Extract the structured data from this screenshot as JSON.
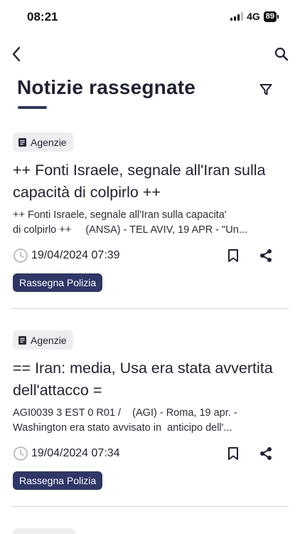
{
  "status": {
    "time": "08:21",
    "network": "4G",
    "battery": "89"
  },
  "header": {
    "title": "Notizie rassegnate"
  },
  "icons": {
    "back": "chevron-left-icon",
    "search": "search-icon",
    "filter": "filter-icon",
    "source": "document-icon",
    "clock": "clock-icon",
    "bookmark": "bookmark-icon",
    "share": "share-icon"
  },
  "colors": {
    "accent": "#2f3767",
    "badge_bg": "#eeeef0",
    "text": "#1f2233"
  },
  "articles": [
    {
      "source": "Agenzie",
      "title": "++ Fonti Israele, segnale all'Iran sulla capacità di colpirlo ++",
      "snippet_line1": "++ Fonti Israele, segnale all'Iran sulla capacita' ",
      "snippet_line2": "di colpirlo ++     (ANSA) - TEL AVIV, 19 APR - \"Un...",
      "datetime": "19/04/2024 07:39",
      "tag": "Rassegna Polizia"
    },
    {
      "source": "Agenzie",
      "title": "== Iran: media, Usa era stata avvertita dell'attacco =",
      "snippet_line1": "AGI0039 3 EST 0 R01 /    (AGI) - Roma, 19 apr. - ",
      "snippet_line2": "Washington era stato avvisato in  anticipo dell'...",
      "datetime": "19/04/2024 07:34",
      "tag": "Rassegna Polizia"
    }
  ]
}
